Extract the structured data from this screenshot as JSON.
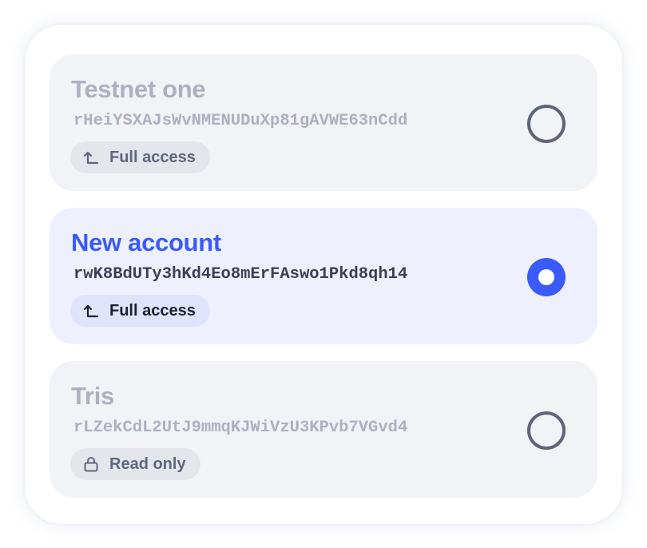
{
  "accounts": [
    {
      "name": "Testnet one",
      "address": "rHeiYSXAJsWvNMENUDuXp81gAVWE63nCdd",
      "access": "Full access",
      "access_icon": "arrow-up-left-icon",
      "selected": false
    },
    {
      "name": "New account",
      "address": "rwK8BdUTy3hKd4Eo8mErFAswo1Pkd8qh14",
      "access": "Full access",
      "access_icon": "arrow-up-left-icon",
      "selected": true
    },
    {
      "name": "Tris",
      "address": "rLZekCdL2UtJ9mmqKJWiVzU3KPvb7VGvd4",
      "access": "Read only",
      "access_icon": "lock-icon",
      "selected": false
    }
  ],
  "colors": {
    "accent": "#3a5afa",
    "card_background": "#f2f3f6",
    "selected_card_background": "#eef0fd",
    "muted_text": "#acb0c0"
  }
}
